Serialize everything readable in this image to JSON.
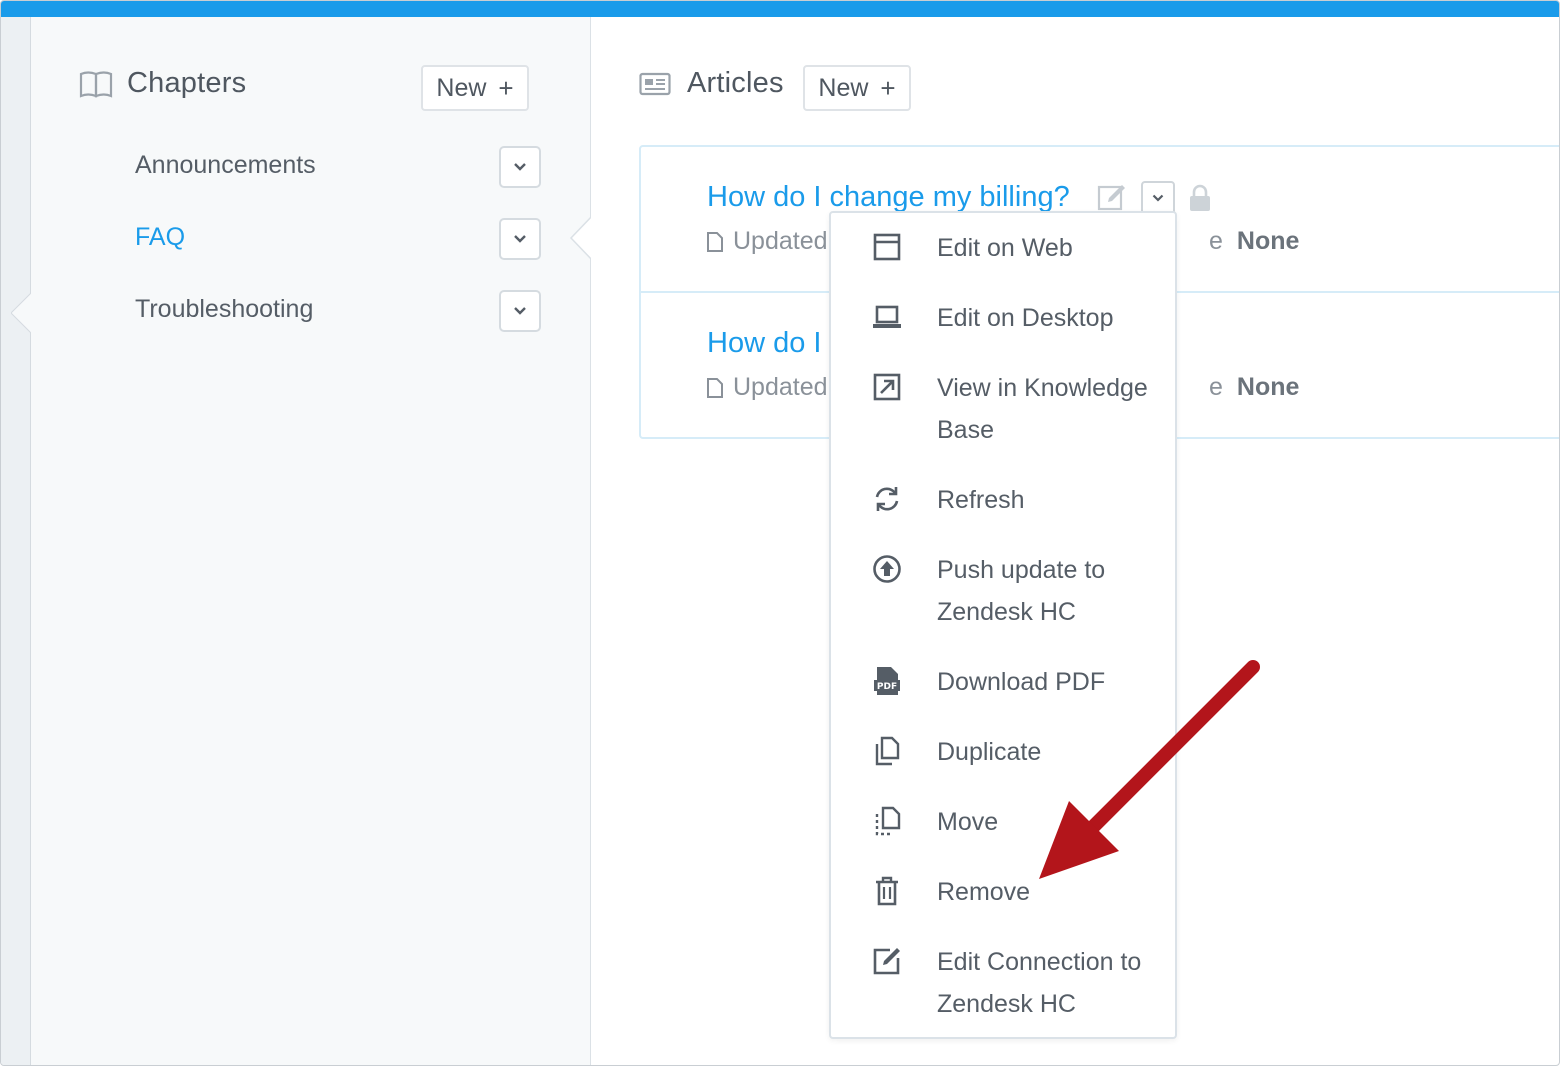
{
  "sidebar": {
    "title": "Chapters",
    "new_label": "New",
    "items": [
      {
        "label": "Announcements",
        "active": false
      },
      {
        "label": "FAQ",
        "active": true
      },
      {
        "label": "Troubleshooting",
        "active": false
      }
    ]
  },
  "articles": {
    "title": "Articles",
    "new_label": "New",
    "rows": [
      {
        "title": "How do I change my billing?",
        "meta": "Updated",
        "right_prefix": "e",
        "right_value": "None"
      },
      {
        "title": "How do I",
        "meta": "Updated",
        "right_prefix": "e",
        "right_value": "None"
      }
    ]
  },
  "context_menu": {
    "items": [
      {
        "label": "Edit on Web",
        "icon": "browser-window-icon"
      },
      {
        "label": "Edit on Desktop",
        "icon": "laptop-icon"
      },
      {
        "label": "View in Knowledge Base",
        "icon": "external-link-icon"
      },
      {
        "label": "Refresh",
        "icon": "refresh-icon"
      },
      {
        "label": "Push update to Zendesk HC",
        "icon": "upload-circle-icon"
      },
      {
        "label": "Download PDF",
        "icon": "pdf-icon"
      },
      {
        "label": "Duplicate",
        "icon": "copy-icon"
      },
      {
        "label": "Move",
        "icon": "move-icon"
      },
      {
        "label": "Remove",
        "icon": "trash-icon"
      },
      {
        "label": "Edit Connection to Zendesk HC",
        "icon": "edit-icon"
      }
    ],
    "pdf_glyph": "PDF"
  },
  "colors": {
    "accent": "#1a9bea",
    "arrow": "#b3151b"
  }
}
